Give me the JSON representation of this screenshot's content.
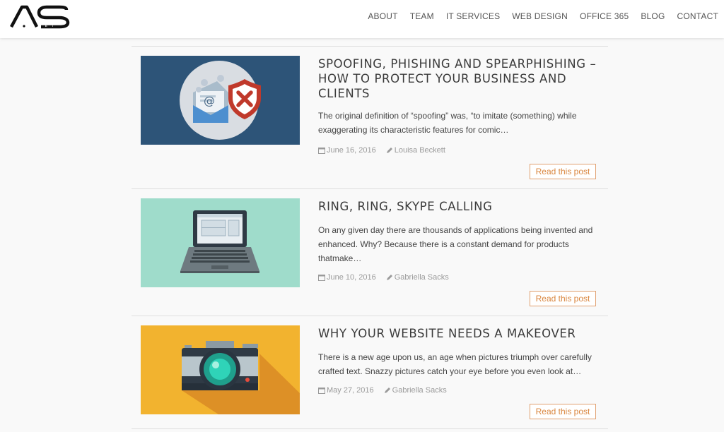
{
  "nav": {
    "items": [
      "ABOUT",
      "TEAM",
      "IT SERVICES",
      "WEB DESIGN",
      "OFFICE 365",
      "BLOG",
      "CONTACT"
    ]
  },
  "logo": {
    "text": "AS",
    "subtext": "NET"
  },
  "posts": [
    {
      "title": "SPOOFING, PHISHING AND SPEARPHISHING – HOW TO PROTECT YOUR BUSINESS AND CLIENTS",
      "excerpt": "The original definition of “spoofing” was, “to imitate (something) while exaggerating its characteristic features for comic…",
      "date": "June 16, 2016",
      "author": "Louisa Beckett",
      "button": "Read this post",
      "thumb_bg": "#2d5478",
      "thumb_icon": "email-shield-icon"
    },
    {
      "title": "RING, RING, SKYPE CALLING",
      "excerpt": "On any given day there are thousands of applications being invented and enhanced. Why? Because there is a constant demand for products thatmake…",
      "date": "June 10, 2016",
      "author": "Gabriella Sacks",
      "button": "Read this post",
      "thumb_bg": "#9fdccb",
      "thumb_icon": "laptop-icon"
    },
    {
      "title": "WHY YOUR WEBSITE NEEDS A MAKEOVER",
      "excerpt": "There is a new age upon us, an age when pictures triumph over carefully crafted text. Snazzy pictures catch your eye before you even look at…",
      "date": "May 27, 2016",
      "author": "Gabriella Sacks",
      "button": "Read this post",
      "thumb_bg": "#f2b32f",
      "thumb_icon": "camera-icon"
    }
  ],
  "colors": {
    "accent": "#d9863f",
    "button_border": "#e0a070",
    "meta": "#9a9a9a"
  }
}
